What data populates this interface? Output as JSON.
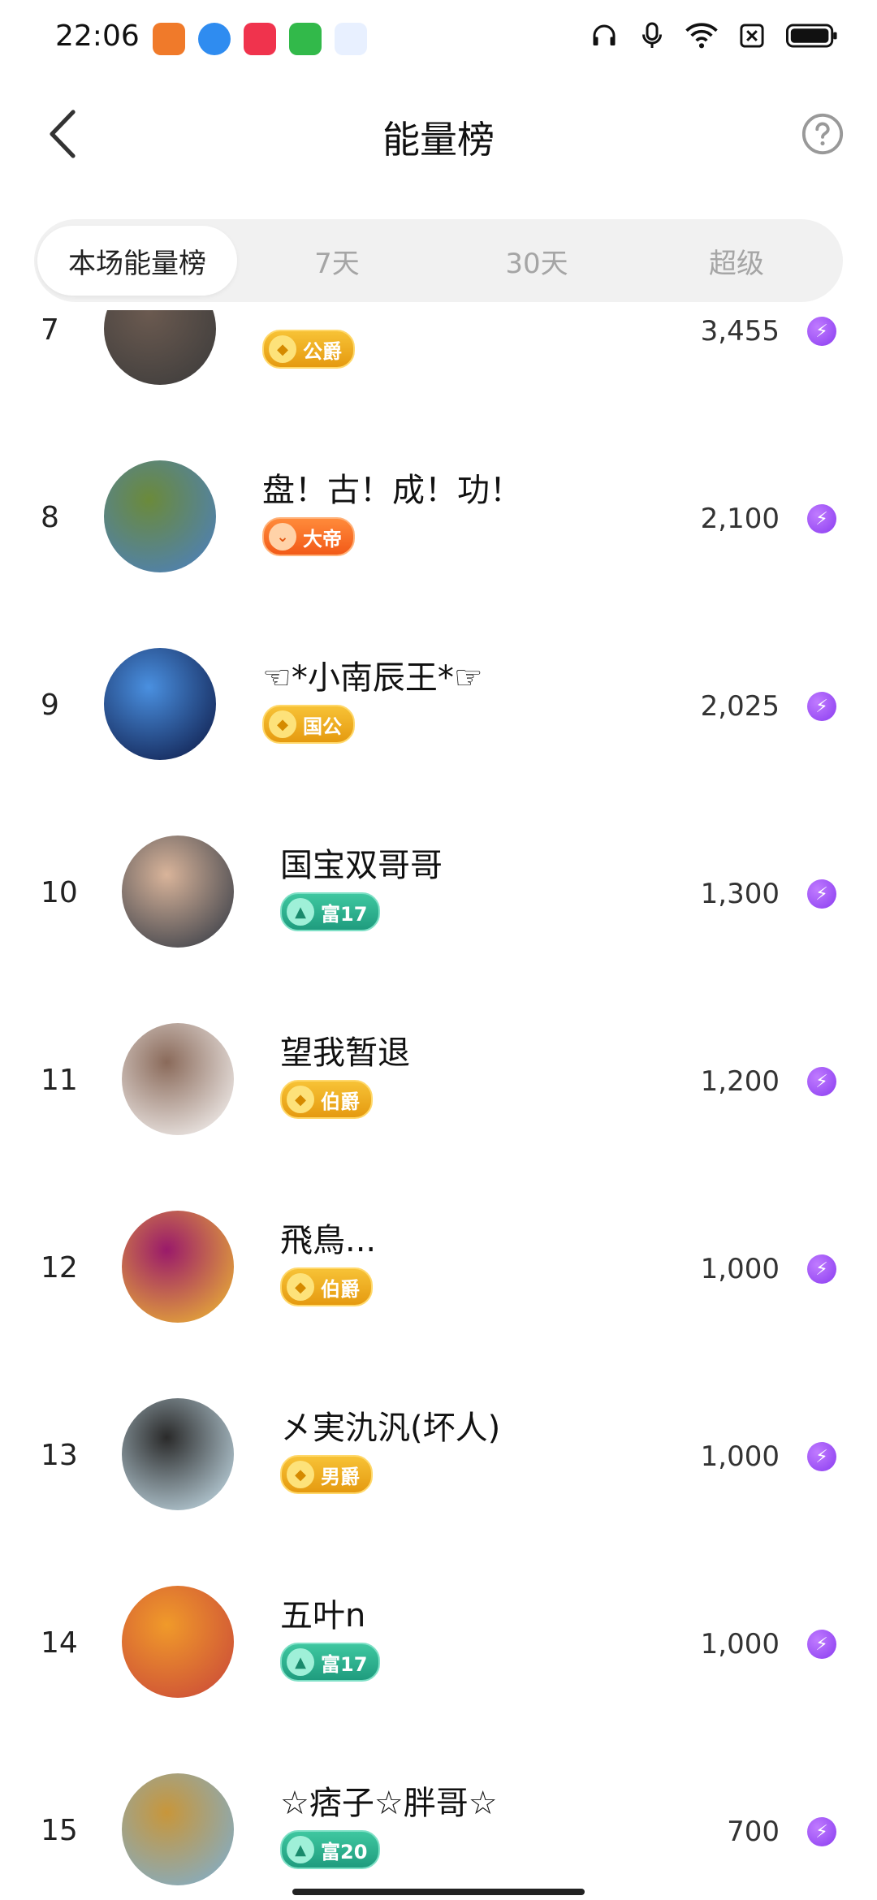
{
  "status_bar": {
    "time": "22:06",
    "icons": [
      "headset-icon",
      "mic-icon",
      "wifi-icon",
      "sim-off-icon",
      "battery-icon"
    ],
    "app_icon_colors": [
      "#f07a2a",
      "#2f8cf0",
      "#f0334d",
      "#32b94a",
      "#2d7fe0"
    ]
  },
  "header": {
    "title": "能量榜",
    "back_icon": "chevron-left-icon",
    "help_icon": "help-circle-icon"
  },
  "tabs": [
    {
      "label": "本场能量榜",
      "active": true
    },
    {
      "label": "7天",
      "active": false
    },
    {
      "label": "30天",
      "active": false
    },
    {
      "label": "超级",
      "active": false
    }
  ],
  "rows": [
    {
      "rank": "7",
      "name": "",
      "badge": "公爵",
      "badge_style": "gold",
      "score": "3,455",
      "avatar_colors": [
        "#3a3a3a",
        "#6b5a50"
      ]
    },
    {
      "rank": "8",
      "name": "盘！古！成！功！",
      "badge": "大帝",
      "badge_style": "orange",
      "score": "2,100",
      "avatar_colors": [
        "#4a7fc8",
        "#6b8a3a"
      ]
    },
    {
      "rank": "9",
      "name": "☜*小南辰王*☞",
      "badge": "国公",
      "badge_style": "gold",
      "score": "2,025",
      "avatar_colors": [
        "#0a1440",
        "#4a90e0"
      ]
    },
    {
      "rank": "10",
      "name": "国宝双哥哥",
      "badge": "富17",
      "badge_style": "teal",
      "score": "1,300",
      "avatar_colors": [
        "#2a3340",
        "#d9b49a"
      ]
    },
    {
      "rank": "11",
      "name": "望我暂退",
      "badge": "伯爵",
      "badge_style": "gold",
      "score": "1,200",
      "avatar_colors": [
        "#ffffff",
        "#8a6a5a"
      ]
    },
    {
      "rank": "12",
      "name": "飛鳥...",
      "badge": "伯爵",
      "badge_style": "gold",
      "score": "1,000",
      "avatar_colors": [
        "#f2c030",
        "#9a1a6a"
      ]
    },
    {
      "rank": "13",
      "name": "㐅実氿汎(坏人)",
      "badge": "男爵",
      "badge_style": "gold",
      "score": "1,000",
      "avatar_colors": [
        "#cfe8f4",
        "#2a2a2a"
      ]
    },
    {
      "rank": "14",
      "name": "五叶n",
      "badge": "富17",
      "badge_style": "teal",
      "score": "1,000",
      "avatar_colors": [
        "#c8443a",
        "#f09a2a"
      ]
    },
    {
      "rank": "15",
      "name": "☆痞子☆胖哥☆",
      "badge": "富20",
      "badge_style": "teal",
      "score": "700",
      "avatar_colors": [
        "#7ab0d8",
        "#c8963a"
      ]
    }
  ],
  "energy_icon": "lightning-icon",
  "energy_color": "#8a3cf0"
}
